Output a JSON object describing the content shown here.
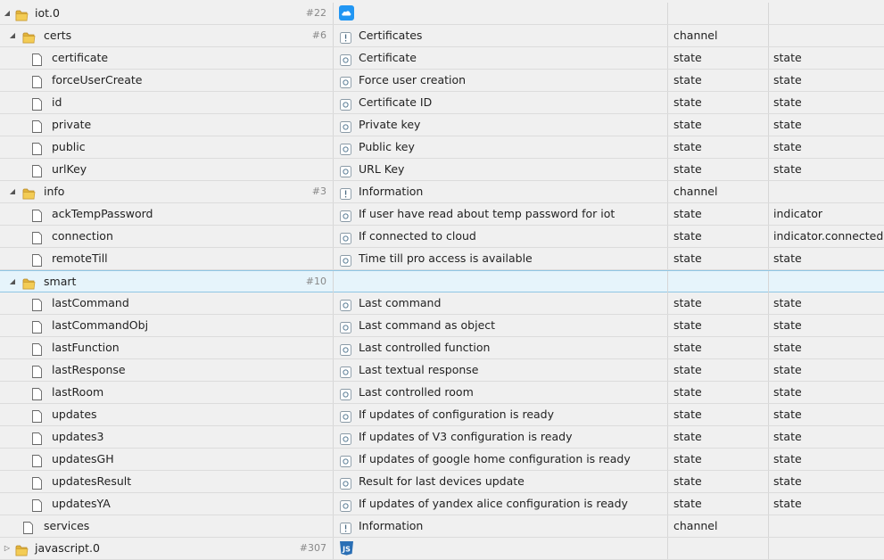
{
  "rows": [
    {
      "name": "iot.0",
      "count": "#22",
      "desc": "",
      "type": "",
      "role": "",
      "icon": "folder",
      "toggle": "expanded",
      "adapter": "cloud-icon",
      "indent": 0
    },
    {
      "name": "certs",
      "count": "#6",
      "desc": "Certificates",
      "type": "channel",
      "role": "",
      "icon": "folder",
      "toggle": "expanded",
      "descIcon": "channel-icon",
      "indent": 1
    },
    {
      "name": "certificate",
      "count": "",
      "desc": "Certificate",
      "type": "state",
      "role": "state",
      "icon": "file",
      "descIcon": "state-icon",
      "indent": 2
    },
    {
      "name": "forceUserCreate",
      "count": "",
      "desc": "Force user creation",
      "type": "state",
      "role": "state",
      "icon": "file",
      "descIcon": "state-icon",
      "indent": 2
    },
    {
      "name": "id",
      "count": "",
      "desc": "Certificate ID",
      "type": "state",
      "role": "state",
      "icon": "file",
      "descIcon": "state-icon",
      "indent": 2
    },
    {
      "name": "private",
      "count": "",
      "desc": "Private key",
      "type": "state",
      "role": "state",
      "icon": "file",
      "descIcon": "state-icon",
      "indent": 2
    },
    {
      "name": "public",
      "count": "",
      "desc": "Public key",
      "type": "state",
      "role": "state",
      "icon": "file",
      "descIcon": "state-icon",
      "indent": 2
    },
    {
      "name": "urlKey",
      "count": "",
      "desc": "URL Key",
      "type": "state",
      "role": "state",
      "icon": "file",
      "descIcon": "state-icon",
      "indent": 2
    },
    {
      "name": "info",
      "count": "#3",
      "desc": "Information",
      "type": "channel",
      "role": "",
      "icon": "folder",
      "toggle": "expanded",
      "descIcon": "channel-icon",
      "indent": 1
    },
    {
      "name": "ackTempPassword",
      "count": "",
      "desc": "If user have read about temp password for iot",
      "type": "state",
      "role": "indicator",
      "icon": "file",
      "descIcon": "state-icon",
      "indent": 2
    },
    {
      "name": "connection",
      "count": "",
      "desc": "If connected to cloud",
      "type": "state",
      "role": "indicator.connected",
      "icon": "file",
      "descIcon": "state-icon",
      "indent": 2
    },
    {
      "name": "remoteTill",
      "count": "",
      "desc": "Time till pro access is available",
      "type": "state",
      "role": "state",
      "icon": "file",
      "descIcon": "state-icon",
      "indent": 2
    },
    {
      "name": "smart",
      "count": "#10",
      "desc": "",
      "type": "",
      "role": "",
      "icon": "folder",
      "toggle": "expanded",
      "selected": true,
      "indent": 1
    },
    {
      "name": "lastCommand",
      "count": "",
      "desc": "Last command",
      "type": "state",
      "role": "state",
      "icon": "file",
      "descIcon": "state-icon",
      "indent": 2
    },
    {
      "name": "lastCommandObj",
      "count": "",
      "desc": "Last command as object",
      "type": "state",
      "role": "state",
      "icon": "file",
      "descIcon": "state-icon",
      "indent": 2
    },
    {
      "name": "lastFunction",
      "count": "",
      "desc": "Last controlled function",
      "type": "state",
      "role": "state",
      "icon": "file",
      "descIcon": "state-icon",
      "indent": 2
    },
    {
      "name": "lastResponse",
      "count": "",
      "desc": "Last textual response",
      "type": "state",
      "role": "state",
      "icon": "file",
      "descIcon": "state-icon",
      "indent": 2
    },
    {
      "name": "lastRoom",
      "count": "",
      "desc": "Last controlled room",
      "type": "state",
      "role": "state",
      "icon": "file",
      "descIcon": "state-icon",
      "indent": 2
    },
    {
      "name": "updates",
      "count": "",
      "desc": "If updates of configuration is ready",
      "type": "state",
      "role": "state",
      "icon": "file",
      "descIcon": "state-icon",
      "indent": 2
    },
    {
      "name": "updates3",
      "count": "",
      "desc": "If updates of V3 configuration is ready",
      "type": "state",
      "role": "state",
      "icon": "file",
      "descIcon": "state-icon",
      "indent": 2
    },
    {
      "name": "updatesGH",
      "count": "",
      "desc": "If updates of google home configuration is ready",
      "type": "state",
      "role": "state",
      "icon": "file",
      "descIcon": "state-icon",
      "indent": 2
    },
    {
      "name": "updatesResult",
      "count": "",
      "desc": "Result for last devices update",
      "type": "state",
      "role": "state",
      "icon": "file",
      "descIcon": "state-icon",
      "indent": 2
    },
    {
      "name": "updatesYA",
      "count": "",
      "desc": "If updates of yandex alice configuration is ready",
      "type": "state",
      "role": "state",
      "icon": "file",
      "descIcon": "state-icon",
      "indent": 2
    },
    {
      "name": "services",
      "count": "",
      "desc": "Information",
      "type": "channel",
      "role": "",
      "icon": "file",
      "descIcon": "channel-icon",
      "indent": 1
    },
    {
      "name": "javascript.0",
      "count": "#307",
      "desc": "",
      "type": "",
      "role": "",
      "icon": "folder",
      "toggle": "collapsed",
      "adapter": "js-icon",
      "indent": 0
    }
  ],
  "colors": {
    "folder": "#e2b43a",
    "selected": "#e6f4fb",
    "cloud": "#2196f3",
    "js": "#2a6fb5"
  }
}
